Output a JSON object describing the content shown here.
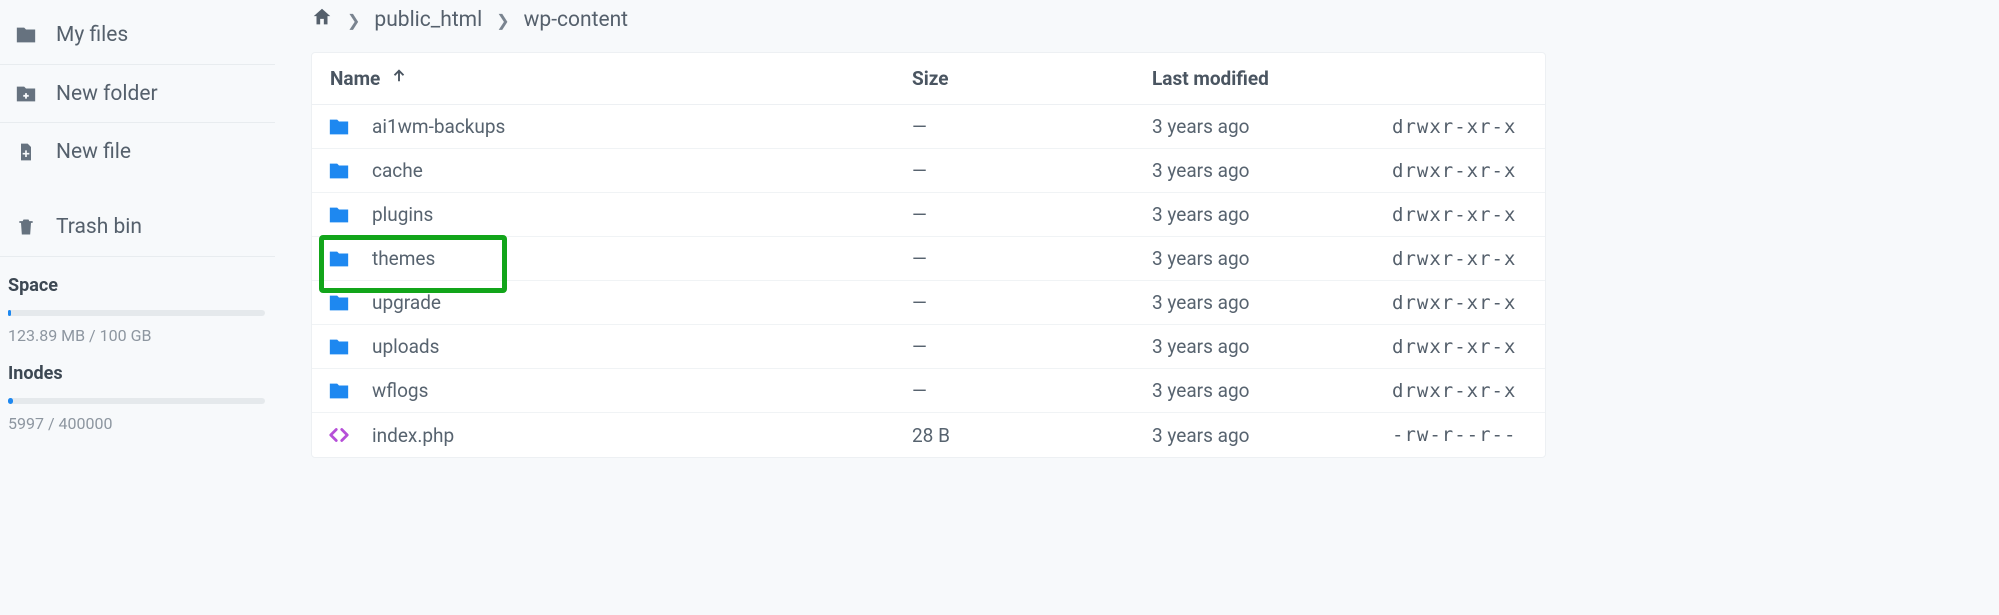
{
  "sidebar": {
    "items": [
      {
        "icon": "folder",
        "label": "My files"
      },
      {
        "icon": "new-folder",
        "label": "New folder"
      },
      {
        "icon": "new-file",
        "label": "New file"
      },
      {
        "icon": "trash",
        "label": "Trash bin"
      }
    ],
    "space": {
      "title": "Space",
      "usage": "123.89 MB / 100 GB",
      "percent": 1
    },
    "inodes": {
      "title": "Inodes",
      "usage": "5997 / 400000",
      "percent": 2
    }
  },
  "breadcrumb": [
    {
      "kind": "home"
    },
    {
      "kind": "text",
      "label": "public_html"
    },
    {
      "kind": "text",
      "label": "wp-content"
    }
  ],
  "columns": {
    "name": "Name",
    "size": "Size",
    "modified": "Last modified"
  },
  "rows": [
    {
      "icon": "folder",
      "name": "ai1wm-backups",
      "size": "—",
      "modified": "3 years ago",
      "perm": "drwxr-xr-x",
      "highlight": false
    },
    {
      "icon": "folder",
      "name": "cache",
      "size": "—",
      "modified": "3 years ago",
      "perm": "drwxr-xr-x",
      "highlight": false
    },
    {
      "icon": "folder",
      "name": "plugins",
      "size": "—",
      "modified": "3 years ago",
      "perm": "drwxr-xr-x",
      "highlight": false
    },
    {
      "icon": "folder",
      "name": "themes",
      "size": "—",
      "modified": "3 years ago",
      "perm": "drwxr-xr-x",
      "highlight": true
    },
    {
      "icon": "folder",
      "name": "upgrade",
      "size": "—",
      "modified": "3 years ago",
      "perm": "drwxr-xr-x",
      "highlight": false
    },
    {
      "icon": "folder",
      "name": "uploads",
      "size": "—",
      "modified": "3 years ago",
      "perm": "drwxr-xr-x",
      "highlight": false
    },
    {
      "icon": "folder",
      "name": "wflogs",
      "size": "—",
      "modified": "3 years ago",
      "perm": "drwxr-xr-x",
      "highlight": false
    },
    {
      "icon": "code",
      "name": "index.php",
      "size": "28 B",
      "modified": "3 years ago",
      "perm": "-rw-r--r--",
      "highlight": false
    }
  ]
}
